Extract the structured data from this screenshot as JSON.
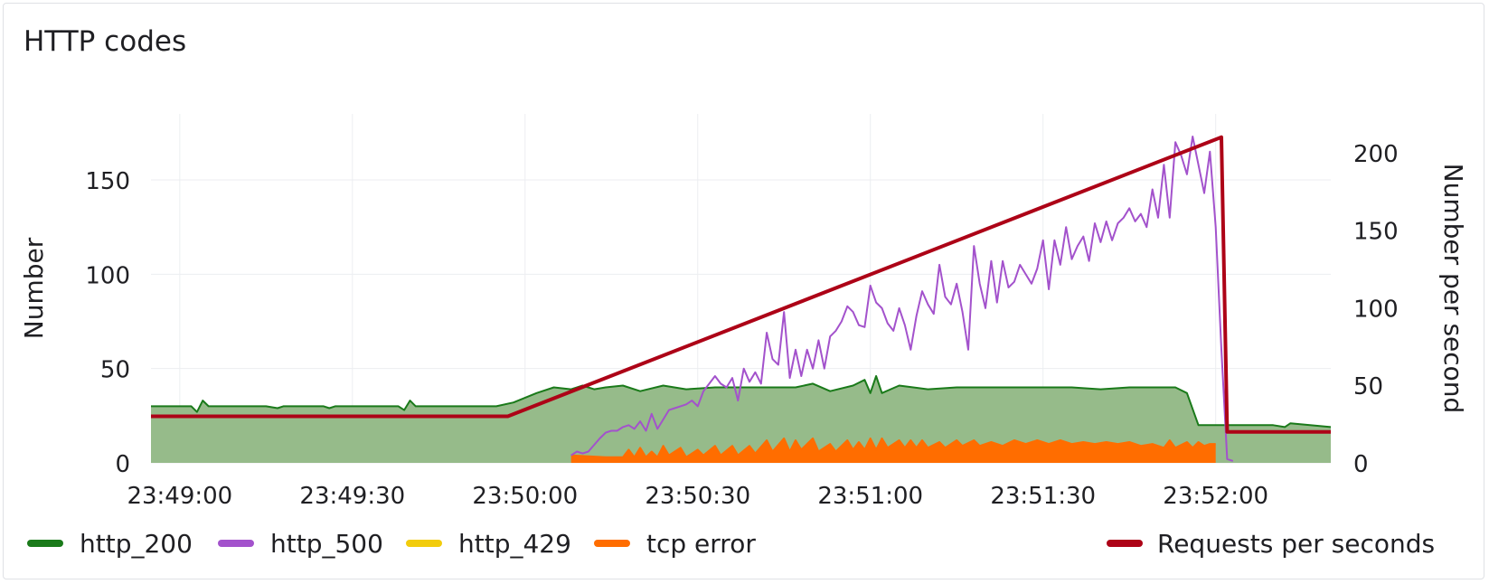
{
  "panel": {
    "title": "HTTP codes"
  },
  "chart_data": {
    "type": "line",
    "title": "HTTP codes",
    "x_ticks": [
      "23:49:00",
      "23:49:30",
      "23:50:00",
      "23:50:30",
      "23:51:00",
      "23:51:30",
      "23:52:00"
    ],
    "x_range": [
      "23:48:55",
      "23:52:20"
    ],
    "y_left": {
      "label": "Number",
      "ticks": [
        0,
        50,
        100,
        150
      ],
      "range": [
        0,
        185
      ]
    },
    "y_right": {
      "label": "Number per second",
      "ticks": [
        0,
        50,
        100,
        150,
        200
      ],
      "range": [
        0,
        225
      ]
    },
    "grid": true,
    "legend_placement": "bottom",
    "series": [
      {
        "name": "http_200",
        "color": "#1a7a1a",
        "fill": "#96bb8a",
        "axis": "left",
        "style": "area",
        "points": [
          [
            "23:48:55",
            30
          ],
          [
            "23:49:02",
            30
          ],
          [
            "23:49:03",
            27
          ],
          [
            "23:49:04",
            33
          ],
          [
            "23:49:05",
            30
          ],
          [
            "23:49:15",
            30
          ],
          [
            "23:49:17",
            29
          ],
          [
            "23:49:18",
            30
          ],
          [
            "23:49:25",
            30
          ],
          [
            "23:49:26",
            29
          ],
          [
            "23:49:27",
            30
          ],
          [
            "23:49:38",
            30
          ],
          [
            "23:49:39",
            28
          ],
          [
            "23:49:40",
            33
          ],
          [
            "23:49:41",
            30
          ],
          [
            "23:49:55",
            30
          ],
          [
            "23:49:58",
            32
          ],
          [
            "23:50:02",
            37
          ],
          [
            "23:50:05",
            40
          ],
          [
            "23:50:08",
            39
          ],
          [
            "23:50:10",
            41
          ],
          [
            "23:50:12",
            39
          ],
          [
            "23:50:14",
            40
          ],
          [
            "23:50:17",
            41
          ],
          [
            "23:50:20",
            38
          ],
          [
            "23:50:24",
            41
          ],
          [
            "23:50:28",
            39
          ],
          [
            "23:50:33",
            40
          ],
          [
            "23:50:40",
            40
          ],
          [
            "23:50:47",
            40
          ],
          [
            "23:50:50",
            42
          ],
          [
            "23:50:53",
            38
          ],
          [
            "23:50:57",
            41
          ],
          [
            "23:50:59",
            44
          ],
          [
            "23:51:00",
            37
          ],
          [
            "23:51:01",
            46
          ],
          [
            "23:51:02",
            37
          ],
          [
            "23:51:05",
            41
          ],
          [
            "23:51:10",
            39
          ],
          [
            "23:51:15",
            40
          ],
          [
            "23:51:25",
            40
          ],
          [
            "23:51:35",
            40
          ],
          [
            "23:51:40",
            39
          ],
          [
            "23:51:45",
            40
          ],
          [
            "23:51:53",
            40
          ],
          [
            "23:51:55",
            37
          ],
          [
            "23:51:57",
            20
          ],
          [
            "23:52:10",
            20
          ],
          [
            "23:52:12",
            19
          ],
          [
            "23:52:13",
            21
          ],
          [
            "23:52:20",
            19
          ]
        ]
      },
      {
        "name": "http_500",
        "color": "#a352cc",
        "axis": "left",
        "style": "line",
        "points": [
          [
            "23:50:08",
            4
          ],
          [
            "23:50:09",
            6
          ],
          [
            "23:50:10",
            5
          ],
          [
            "23:50:11",
            6
          ],
          [
            "23:50:13",
            13
          ],
          [
            "23:50:14",
            16
          ],
          [
            "23:50:15",
            17
          ],
          [
            "23:50:16",
            17
          ],
          [
            "23:50:17",
            19
          ],
          [
            "23:50:18",
            20
          ],
          [
            "23:50:19",
            18
          ],
          [
            "23:50:20",
            22
          ],
          [
            "23:50:21",
            17
          ],
          [
            "23:50:22",
            26
          ],
          [
            "23:50:23",
            18
          ],
          [
            "23:50:24",
            23
          ],
          [
            "23:50:25",
            28
          ],
          [
            "23:50:26",
            29
          ],
          [
            "23:50:27",
            30
          ],
          [
            "23:50:28",
            31
          ],
          [
            "23:50:29",
            33
          ],
          [
            "23:50:30",
            30
          ],
          [
            "23:50:31",
            38
          ],
          [
            "23:50:32",
            42
          ],
          [
            "23:50:33",
            46
          ],
          [
            "23:50:34",
            42
          ],
          [
            "23:50:35",
            40
          ],
          [
            "23:50:36",
            45
          ],
          [
            "23:50:37",
            33
          ],
          [
            "23:50:38",
            50
          ],
          [
            "23:50:39",
            43
          ],
          [
            "23:50:40",
            48
          ],
          [
            "23:50:41",
            42
          ],
          [
            "23:50:42",
            69
          ],
          [
            "23:50:43",
            55
          ],
          [
            "23:50:44",
            52
          ],
          [
            "23:50:45",
            80
          ],
          [
            "23:50:46",
            45
          ],
          [
            "23:50:47",
            60
          ],
          [
            "23:50:48",
            46
          ],
          [
            "23:50:49",
            60
          ],
          [
            "23:50:50",
            50
          ],
          [
            "23:50:51",
            65
          ],
          [
            "23:50:52",
            50
          ],
          [
            "23:50:53",
            67
          ],
          [
            "23:50:54",
            70
          ],
          [
            "23:50:55",
            75
          ],
          [
            "23:50:56",
            83
          ],
          [
            "23:50:57",
            80
          ],
          [
            "23:50:58",
            73
          ],
          [
            "23:50:59",
            72
          ],
          [
            "23:51:00",
            94
          ],
          [
            "23:51:01",
            85
          ],
          [
            "23:51:02",
            82
          ],
          [
            "23:51:03",
            74
          ],
          [
            "23:51:04",
            70
          ],
          [
            "23:51:05",
            82
          ],
          [
            "23:51:06",
            73
          ],
          [
            "23:51:07",
            60
          ],
          [
            "23:51:08",
            78
          ],
          [
            "23:51:09",
            91
          ],
          [
            "23:51:10",
            84
          ],
          [
            "23:51:11",
            79
          ],
          [
            "23:51:12",
            105
          ],
          [
            "23:51:13",
            88
          ],
          [
            "23:51:14",
            84
          ],
          [
            "23:51:15",
            95
          ],
          [
            "23:51:16",
            80
          ],
          [
            "23:51:17",
            60
          ],
          [
            "23:51:18",
            115
          ],
          [
            "23:51:19",
            95
          ],
          [
            "23:51:20",
            82
          ],
          [
            "23:51:21",
            107
          ],
          [
            "23:51:22",
            85
          ],
          [
            "23:51:23",
            107
          ],
          [
            "23:51:24",
            93
          ],
          [
            "23:51:25",
            96
          ],
          [
            "23:51:26",
            105
          ],
          [
            "23:51:27",
            100
          ],
          [
            "23:51:28",
            95
          ],
          [
            "23:51:29",
            103
          ],
          [
            "23:51:30",
            118
          ],
          [
            "23:51:31",
            92
          ],
          [
            "23:51:32",
            118
          ],
          [
            "23:51:33",
            105
          ],
          [
            "23:51:34",
            125
          ],
          [
            "23:51:35",
            108
          ],
          [
            "23:51:36",
            115
          ],
          [
            "23:51:37",
            120
          ],
          [
            "23:51:38",
            107
          ],
          [
            "23:51:39",
            127
          ],
          [
            "23:51:40",
            117
          ],
          [
            "23:51:41",
            128
          ],
          [
            "23:51:42",
            118
          ],
          [
            "23:51:43",
            127
          ],
          [
            "23:51:44",
            130
          ],
          [
            "23:51:45",
            135
          ],
          [
            "23:51:46",
            128
          ],
          [
            "23:51:47",
            132
          ],
          [
            "23:51:48",
            125
          ],
          [
            "23:51:49",
            145
          ],
          [
            "23:51:50",
            130
          ],
          [
            "23:51:51",
            158
          ],
          [
            "23:51:52",
            130
          ],
          [
            "23:51:53",
            170
          ],
          [
            "23:51:54",
            163
          ],
          [
            "23:51:55",
            153
          ],
          [
            "23:51:56",
            173
          ],
          [
            "23:51:57",
            158
          ],
          [
            "23:51:58",
            143
          ],
          [
            "23:51:59",
            165
          ],
          [
            "23:52:00",
            125
          ],
          [
            "23:52:01",
            60
          ],
          [
            "23:52:02",
            2
          ],
          [
            "23:52:03",
            1
          ]
        ]
      },
      {
        "name": "http_429",
        "color": "#f2cc0c",
        "axis": "left",
        "style": "line",
        "points": []
      },
      {
        "name": "tcp error",
        "color": "#ff6d00",
        "fill": "#ff6d00",
        "axis": "left",
        "style": "area",
        "points": [
          [
            "23:50:08",
            4
          ],
          [
            "23:50:14",
            3
          ],
          [
            "23:50:17",
            3
          ],
          [
            "23:50:18",
            7
          ],
          [
            "23:50:19",
            3
          ],
          [
            "23:50:20",
            8
          ],
          [
            "23:50:21",
            3
          ],
          [
            "23:50:22",
            6
          ],
          [
            "23:50:23",
            3
          ],
          [
            "23:50:24",
            9
          ],
          [
            "23:50:25",
            4
          ],
          [
            "23:50:27",
            8
          ],
          [
            "23:50:28",
            3
          ],
          [
            "23:50:30",
            7
          ],
          [
            "23:50:31",
            4
          ],
          [
            "23:50:33",
            9
          ],
          [
            "23:50:34",
            4
          ],
          [
            "23:50:36",
            9
          ],
          [
            "23:50:37",
            4
          ],
          [
            "23:50:39",
            9
          ],
          [
            "23:50:40",
            5
          ],
          [
            "23:50:42",
            12
          ],
          [
            "23:50:43",
            6
          ],
          [
            "23:50:45",
            13
          ],
          [
            "23:50:46",
            6
          ],
          [
            "23:50:47",
            12
          ],
          [
            "23:50:48",
            7
          ],
          [
            "23:50:50",
            13
          ],
          [
            "23:50:51",
            6
          ],
          [
            "23:50:53",
            10
          ],
          [
            "23:50:54",
            6
          ],
          [
            "23:50:56",
            12
          ],
          [
            "23:50:57",
            7
          ],
          [
            "23:50:58",
            11
          ],
          [
            "23:50:59",
            7
          ],
          [
            "23:51:00",
            13
          ],
          [
            "23:51:01",
            7
          ],
          [
            "23:51:02",
            13
          ],
          [
            "23:51:03",
            8
          ],
          [
            "23:51:05",
            12
          ],
          [
            "23:51:06",
            8
          ],
          [
            "23:51:07",
            12
          ],
          [
            "23:51:08",
            8
          ],
          [
            "23:51:09",
            12
          ],
          [
            "23:51:10",
            8
          ],
          [
            "23:51:12",
            11
          ],
          [
            "23:51:13",
            8
          ],
          [
            "23:51:15",
            12
          ],
          [
            "23:51:16",
            9
          ],
          [
            "23:51:18",
            12
          ],
          [
            "23:51:19",
            9
          ],
          [
            "23:51:21",
            11
          ],
          [
            "23:51:23",
            9
          ],
          [
            "23:51:25",
            12
          ],
          [
            "23:51:27",
            10
          ],
          [
            "23:51:29",
            12
          ],
          [
            "23:51:31",
            10
          ],
          [
            "23:51:33",
            12
          ],
          [
            "23:51:35",
            10
          ],
          [
            "23:51:37",
            11
          ],
          [
            "23:51:39",
            10
          ],
          [
            "23:51:41",
            11
          ],
          [
            "23:51:43",
            10
          ],
          [
            "23:51:45",
            11
          ],
          [
            "23:51:47",
            9
          ],
          [
            "23:51:49",
            10
          ],
          [
            "23:51:51",
            8
          ],
          [
            "23:51:52",
            12
          ],
          [
            "23:51:53",
            8
          ],
          [
            "23:51:55",
            11
          ],
          [
            "23:51:56",
            8
          ],
          [
            "23:51:57",
            11
          ],
          [
            "23:51:58",
            9
          ],
          [
            "23:51:59",
            10
          ],
          [
            "23:52:00",
            10
          ]
        ]
      },
      {
        "name": "Requests per seconds",
        "color": "#ad0317",
        "axis": "right",
        "style": "line",
        "points": [
          [
            "23:48:55",
            30
          ],
          [
            "23:49:57",
            30
          ],
          [
            "23:52:01",
            210
          ],
          [
            "23:52:02",
            20
          ],
          [
            "23:52:20",
            20
          ]
        ]
      }
    ]
  },
  "legend": {
    "items": [
      {
        "label": "http_200",
        "color": "#1a7a1a"
      },
      {
        "label": "http_500",
        "color": "#a352cc"
      },
      {
        "label": "http_429",
        "color": "#f2cc0c"
      },
      {
        "label": "tcp error",
        "color": "#ff6d00"
      }
    ],
    "right_item": {
      "label": "Requests per seconds",
      "color": "#ad0317"
    }
  }
}
